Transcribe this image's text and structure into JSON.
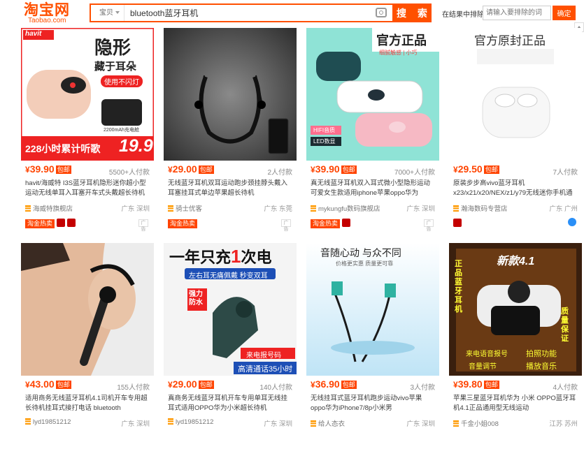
{
  "header": {
    "logo_cn": "淘宝网",
    "logo_en": "Taobao.com",
    "scope": "宝贝",
    "query": "bluetooth蓝牙耳机",
    "search_label": "搜 索",
    "exclude_label": "在结果中排除",
    "exclude_placeholder": "请输入要排除的词",
    "exclude_button": "确定"
  },
  "items": [
    {
      "price": "39.90",
      "pricebadge": "包邮",
      "sold": "5500+人付款",
      "title": "havit/海威特 I3S蓝牙耳机隐形迷你超小型运动无线单耳入耳塞开车式头戴超长待机通",
      "shop": "海威特旗舰店",
      "loc": "广东 深圳",
      "tag": "淘金热卖",
      "extra": "广告"
    },
    {
      "price": "29.00",
      "pricebadge": "包邮",
      "sold": "2人付款",
      "title": "无线蓝牙耳机双耳运动跑步颈挂脖头戴入耳塞挂耳式单边苹果超长待机",
      "shop": "骑士优客",
      "loc": "广东 东莞",
      "tag": "淘金热卖",
      "extra": "广告"
    },
    {
      "price": "39.90",
      "pricebadge": "包邮",
      "sold": "7000+人付款",
      "title": "真无线蓝牙耳机双入耳式微小型隐形运动可爱女生款适用iphone苹果oppo华为",
      "shop": "mykungfu数码旗舰店",
      "loc": "广东 深圳",
      "tag": "淘金热卖",
      "extra": "广告"
    },
    {
      "price": "29.50",
      "pricebadge": "包邮",
      "sold": "7人付款",
      "title": "原装步步高vivo蓝牙耳机x23/x21/x20/NEX/z1/y79无线迷你手机通用",
      "shop": "瀚海数码专营店",
      "loc": "广东 广州",
      "tag": "",
      "extra": ""
    },
    {
      "price": "43.00",
      "pricebadge": "包邮",
      "sold": "155人付款",
      "title": "适用商务无线蓝牙耳机4.1司机开车专用超长待机挂耳式接打电话 bluetooth",
      "shop": "lyd19851212",
      "loc": "广东 深圳",
      "tag": "",
      "extra": ""
    },
    {
      "price": "29.00",
      "pricebadge": "包邮",
      "sold": "140人付款",
      "title": "真商务无线蓝牙耳机开车专用单耳无线挂耳式适用OPPO华为小米超长待机",
      "shop": "lyd19851212",
      "loc": "广东 深圳",
      "tag": "",
      "extra": ""
    },
    {
      "price": "36.90",
      "pricebadge": "包邮",
      "sold": "3人付款",
      "title": "无线挂耳式蓝牙耳机跑步运动vivo苹果oppo华为iPhone7/8p小米男",
      "shop": "给人态衣",
      "loc": "广东 深圳",
      "tag": "",
      "extra": ""
    },
    {
      "price": "39.80",
      "pricebadge": "包邮",
      "sold": "4人付款",
      "title": "苹果三星蓝牙耳机华为 小米 OPPO蓝牙耳机4.1正品通用型无线运动",
      "shop": "千金小姐008",
      "loc": "江苏 苏州",
      "tag": "",
      "extra": ""
    }
  ],
  "images": {
    "img1": {
      "line1": "隐形",
      "line2": "藏于耳朵",
      "line3": "使用不闪灯",
      "bar": "228小时累计听歌",
      "price": "19.9",
      "brand": "havit",
      "cap": "2200mAh充电舱"
    },
    "img2": {},
    "img3": {
      "line1": "官方正品",
      "line2": "细腻触感 | 小巧",
      "tag1": "HIFI音质",
      "tag2": "LED数显"
    },
    "img4": {
      "line1": "官方原封正品"
    },
    "img5": {},
    "img6": {
      "line1": "一年只充",
      "num": "1",
      "line1b": "次电",
      "line2": "左右耳无痛佩戴 秒变双耳",
      "tag": "强力防水",
      "cap1": "来电报号码",
      "cap2": "高清通话35小时"
    },
    "img7": {
      "line1": "音随心动 与众不同",
      "line2": "价格更实惠 质量更可靠"
    },
    "img8": {
      "line1": "新款4.1",
      "side": "正品蓝牙耳机",
      "q": "质量保证",
      "c1": "来电语音报号",
      "c2": "音量调节",
      "c3": "拍照功能",
      "c4": "播放音乐"
    }
  },
  "colors": {
    "accent": "#ff5000",
    "price": "#ff4400"
  }
}
